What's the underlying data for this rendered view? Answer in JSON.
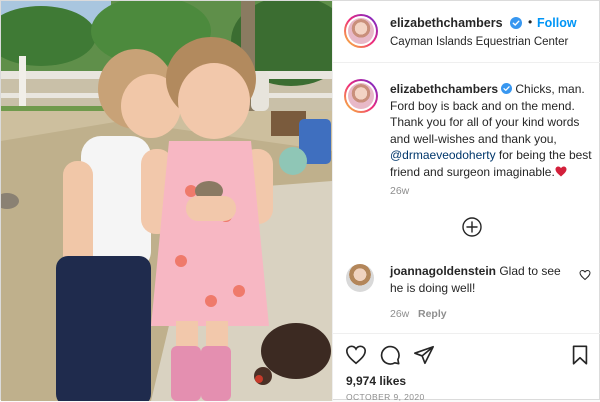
{
  "post": {
    "image_alt": "Two children at the equestrian center, the boy kissing the girl's cheek while she holds a chick",
    "header": {
      "username": "elizabethchambers",
      "verified": true,
      "dot": "•",
      "follow_label": "Follow",
      "location": "Cayman Islands Equestrian Center"
    },
    "caption": {
      "username": "elizabethchambers",
      "text_before": " Chicks, man. Ford boy is back and on the mend. Thank you for all of your kind words and well-wishes and thank you, ",
      "mention": "@drmaeveodoherty",
      "text_after": " for being the best friend and surgeon imaginable.",
      "emoji": "red-heart",
      "time": "26w"
    },
    "load_more_icon": "plus-circle-icon",
    "comments": [
      {
        "username": "joannagoldenstein",
        "text": " Glad to see he is doing well!",
        "time": "26w",
        "reply_label": "Reply"
      }
    ],
    "actions": {
      "icons": [
        "heart-icon",
        "comment-icon",
        "share-icon",
        "bookmark-icon"
      ],
      "likes": "9,974 likes",
      "date": "OCTOBER 9, 2020"
    },
    "colors": {
      "link_blue": "#0095f6",
      "mention_blue": "#00376b",
      "muted": "#8e8e8e",
      "heart_red": "#e0245e"
    }
  }
}
